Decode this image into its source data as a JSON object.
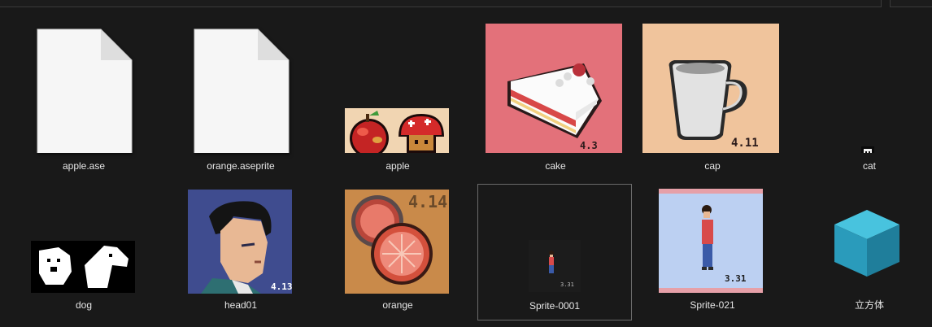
{
  "window": {
    "view": "large-icons",
    "background": "#191919",
    "selected_item": "Sprite-0001"
  },
  "files": [
    {
      "id": "apple_ase",
      "name": "apple.ase",
      "icon": "generic-file-icon"
    },
    {
      "id": "orange_aseprite",
      "name": "orange.aseprite",
      "icon": "generic-file-icon"
    },
    {
      "id": "apple",
      "name": "apple",
      "icon": "apple-mushroom-thumbnail"
    },
    {
      "id": "cake",
      "name": "cake",
      "icon": "cake-slice-thumbnail",
      "thumb_text": "4.3",
      "bg": "#e3717a"
    },
    {
      "id": "cap",
      "name": "cap",
      "icon": "cup-thumbnail",
      "thumb_text": "4.11",
      "bg": "#f0c49c"
    },
    {
      "id": "cat",
      "name": "cat",
      "icon": "cat-tiny-thumbnail"
    },
    {
      "id": "dog",
      "name": "dog",
      "icon": "dog-thumbnail"
    },
    {
      "id": "head01",
      "name": "head01",
      "icon": "head-portrait-thumbnail",
      "thumb_text": "4.13",
      "bg": "#3f4c8f"
    },
    {
      "id": "orange",
      "name": "orange",
      "icon": "grapefruit-thumbnail",
      "thumb_text": "4.14",
      "bg": "#c98a4a"
    },
    {
      "id": "sprite0001",
      "name": "Sprite-0001",
      "icon": "sprite-person-small-thumbnail",
      "thumb_text": "3.31"
    },
    {
      "id": "sprite021",
      "name": "Sprite-021",
      "icon": "sprite-person-thumbnail",
      "thumb_text": "3.31",
      "bg": "#bcd0f2"
    },
    {
      "id": "cube",
      "name": "立方体",
      "icon": "cube-icon",
      "color": "#2aa7c6"
    }
  ]
}
